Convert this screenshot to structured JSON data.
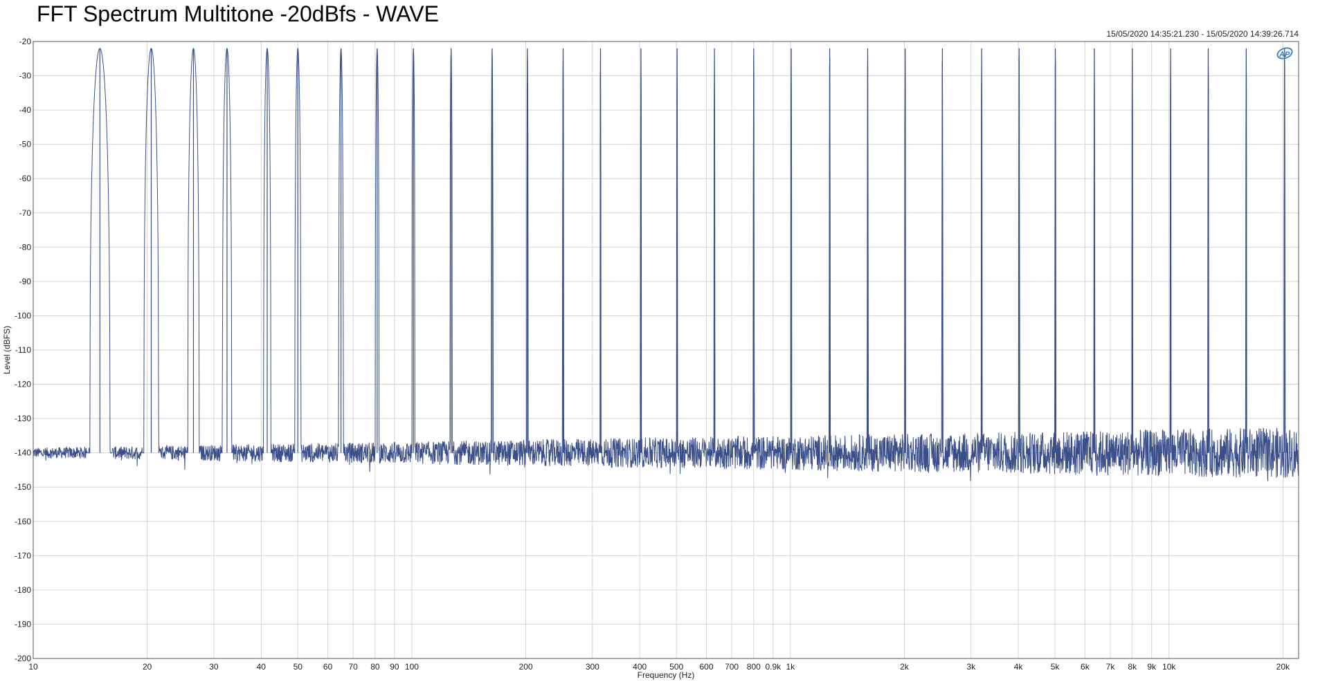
{
  "chart_data": {
    "type": "line",
    "title": "FFT Spectrum Multitone -20dBfs - WAVE",
    "timestamp": "15/05/2020 14:35:21.230 - 15/05/2020 14:39:26.714",
    "xlabel": "Frequency (Hz)",
    "ylabel": "Level (dBFS)",
    "x_scale": "log",
    "xlim": [
      10,
      22000
    ],
    "ylim": [
      -200,
      -20
    ],
    "grid": true,
    "x_ticks": [
      {
        "v": 10,
        "label": "10"
      },
      {
        "v": 20,
        "label": "20"
      },
      {
        "v": 30,
        "label": "30"
      },
      {
        "v": 40,
        "label": "40"
      },
      {
        "v": 50,
        "label": "50"
      },
      {
        "v": 60,
        "label": "60"
      },
      {
        "v": 70,
        "label": "70"
      },
      {
        "v": 80,
        "label": "80"
      },
      {
        "v": 90,
        "label": "90"
      },
      {
        "v": 100,
        "label": "100"
      },
      {
        "v": 200,
        "label": "200"
      },
      {
        "v": 300,
        "label": "300"
      },
      {
        "v": 400,
        "label": "400"
      },
      {
        "v": 500,
        "label": "500"
      },
      {
        "v": 600,
        "label": "600"
      },
      {
        "v": 700,
        "label": "700"
      },
      {
        "v": 800,
        "label": "800"
      },
      {
        "v": 900,
        "label": "0.9k"
      },
      {
        "v": 1000,
        "label": "1k"
      },
      {
        "v": 2000,
        "label": "2k"
      },
      {
        "v": 3000,
        "label": "3k"
      },
      {
        "v": 4000,
        "label": "4k"
      },
      {
        "v": 5000,
        "label": "5k"
      },
      {
        "v": 6000,
        "label": "6k"
      },
      {
        "v": 7000,
        "label": "7k"
      },
      {
        "v": 8000,
        "label": "8k"
      },
      {
        "v": 9000,
        "label": "9k"
      },
      {
        "v": 10000,
        "label": "10k"
      },
      {
        "v": 20000,
        "label": "20k"
      }
    ],
    "y_ticks": [
      -20,
      -30,
      -40,
      -50,
      -60,
      -70,
      -80,
      -90,
      -100,
      -110,
      -120,
      -130,
      -140,
      -150,
      -160,
      -170,
      -180,
      -190,
      -200
    ],
    "series": [
      {
        "color": "#3a4f8a",
        "noise_floor_db": -140,
        "tone_peak_db": -22,
        "tones_hz": [
          15,
          20.5,
          26.5,
          32.5,
          41.5,
          50,
          65,
          81,
          101,
          127,
          163,
          202,
          251,
          315,
          403,
          502,
          630,
          800,
          1005,
          1270,
          1600,
          2010,
          2520,
          3200,
          4020,
          5010,
          6350,
          8000,
          10100,
          12700,
          16000,
          20200
        ]
      }
    ]
  }
}
